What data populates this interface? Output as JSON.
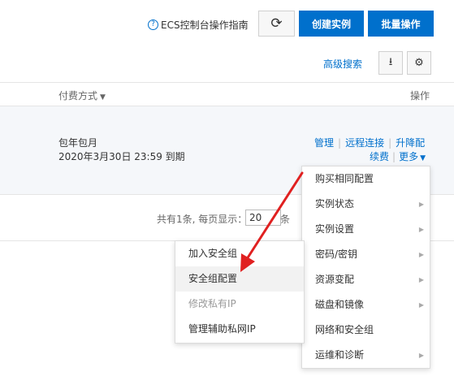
{
  "header": {
    "guide_icon": "?",
    "guide_label": "ECS控制台操作指南",
    "refresh_icon": "⟳",
    "create_label": "创建实例",
    "batch_label": "批量操作"
  },
  "toolbar": {
    "advanced_search": "高级搜索",
    "export_icon": "⭳",
    "settings_icon": "⚙"
  },
  "table": {
    "columns": {
      "pay": "付费方式",
      "ops": "操作"
    },
    "row": {
      "pay_type": "包年包月",
      "expire": "2020年3月30日 23:59 到期",
      "ops_line1": [
        "管理",
        "远程连接",
        "升降配"
      ],
      "ops_line2": [
        "续费",
        "更多"
      ]
    }
  },
  "pagination": {
    "total_text": "共有1条, 每页显示：",
    "page_size": "20",
    "unit": "条"
  },
  "main_menu": {
    "items": [
      {
        "label": "购买相同配置",
        "submenu": false
      },
      {
        "label": "实例状态",
        "submenu": true
      },
      {
        "label": "实例设置",
        "submenu": true
      },
      {
        "label": "密码/密钥",
        "submenu": true
      },
      {
        "label": "资源变配",
        "submenu": true
      },
      {
        "label": "磁盘和镜像",
        "submenu": true
      },
      {
        "label": "网络和安全组",
        "submenu": false
      },
      {
        "label": "运维和诊断",
        "submenu": true
      }
    ]
  },
  "sub_menu": {
    "items": [
      {
        "label": "加入安全组",
        "state": "normal"
      },
      {
        "label": "安全组配置",
        "state": "hover"
      },
      {
        "label": "修改私有IP",
        "state": "disabled"
      },
      {
        "label": "管理辅助私网IP",
        "state": "normal"
      }
    ]
  },
  "colors": {
    "primary": "#0070cc",
    "annotation_arrow": "#e02020"
  }
}
